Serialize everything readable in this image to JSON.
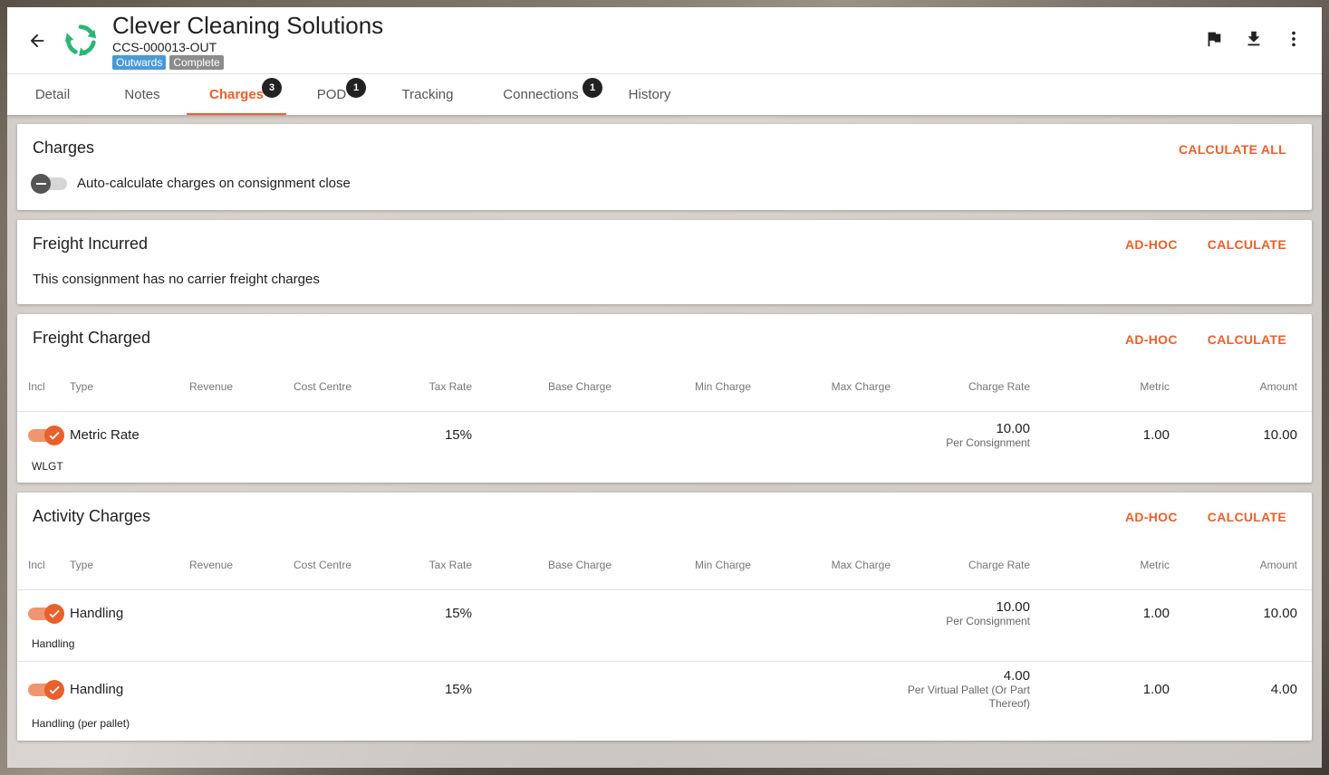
{
  "header": {
    "title": "Clever Cleaning Solutions",
    "subtitle": "CCS-000013-OUT",
    "badges": [
      "Outwards",
      "Complete"
    ]
  },
  "tabs": [
    {
      "label": "Detail"
    },
    {
      "label": "Notes"
    },
    {
      "label": "Charges",
      "count": "3"
    },
    {
      "label": "POD",
      "count": "1"
    },
    {
      "label": "Tracking"
    },
    {
      "label": "Connections",
      "count": "1"
    },
    {
      "label": "History"
    }
  ],
  "charges_card": {
    "title": "Charges",
    "calculate_all": "CALCULATE ALL",
    "auto_calc_label": "Auto-calculate charges on consignment close"
  },
  "freight_incurred": {
    "title": "Freight Incurred",
    "adhoc": "AD-HOC",
    "calculate": "CALCULATE",
    "empty_text": "This consignment has no carrier freight charges"
  },
  "columns": [
    "Incl",
    "Type",
    "Revenue",
    "Cost Centre",
    "Tax Rate",
    "Base Charge",
    "Min Charge",
    "Max Charge",
    "Charge Rate",
    "Metric",
    "Amount"
  ],
  "freight_charged": {
    "title": "Freight Charged",
    "adhoc": "AD-HOC",
    "calculate": "CALCULATE",
    "rows": [
      {
        "type": "Metric Rate",
        "tax_rate": "15%",
        "charge_rate": "10.00",
        "rate_unit": "Per Consignment",
        "metric": "1.00",
        "amount": "10.00",
        "tag": "WLGT"
      }
    ]
  },
  "activity_charges": {
    "title": "Activity Charges",
    "adhoc": "AD-HOC",
    "calculate": "CALCULATE",
    "rows": [
      {
        "type": "Handling",
        "tax_rate": "15%",
        "charge_rate": "10.00",
        "rate_unit": "Per Consignment",
        "metric": "1.00",
        "amount": "10.00",
        "tag": "Handling"
      },
      {
        "type": "Handling",
        "tax_rate": "15%",
        "charge_rate": "4.00",
        "rate_unit_line1": "Per Virtual Pallet (Or Part",
        "rate_unit_line2": "Thereof)",
        "metric": "1.00",
        "amount": "4.00",
        "tag": "Handling (per pallet)"
      }
    ]
  },
  "colors": {
    "accent": "#e8602c",
    "badge_blue": "#4a9ad6",
    "badge_grey": "#8c8c8c",
    "logo_green": "#2bb673"
  },
  "icons": [
    "arrow-left-icon",
    "recycle-logo-icon",
    "flag-icon",
    "download-icon",
    "more-vert-icon",
    "check-icon",
    "minus-icon"
  ]
}
